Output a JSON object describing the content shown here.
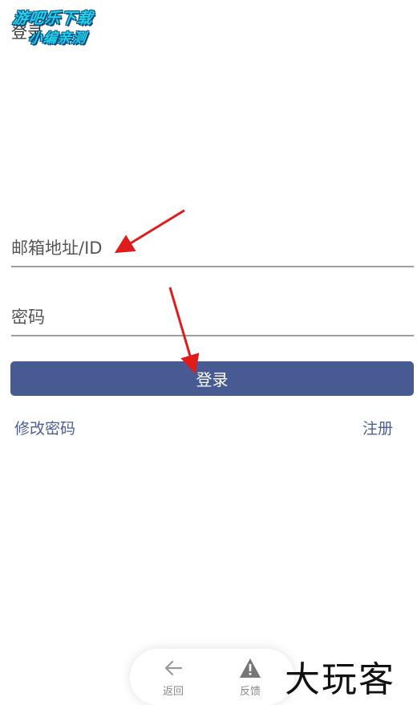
{
  "header": {
    "title": "登录"
  },
  "watermark": {
    "line1": "游吧乐下载",
    "line2": "小编亲测"
  },
  "form": {
    "email_placeholder": "邮箱地址/ID",
    "password_placeholder": "密码",
    "login_label": "登录"
  },
  "links": {
    "change_password": "修改密码",
    "register": "注册"
  },
  "bottom_nav": {
    "back_label": "返回",
    "feedback_label": "反馈"
  },
  "brand": {
    "text": "大玩客"
  },
  "colors": {
    "accent": "#475a92",
    "link": "#4a5f97",
    "annotation": "#e01b1b",
    "watermark": "#1ed4e6"
  }
}
